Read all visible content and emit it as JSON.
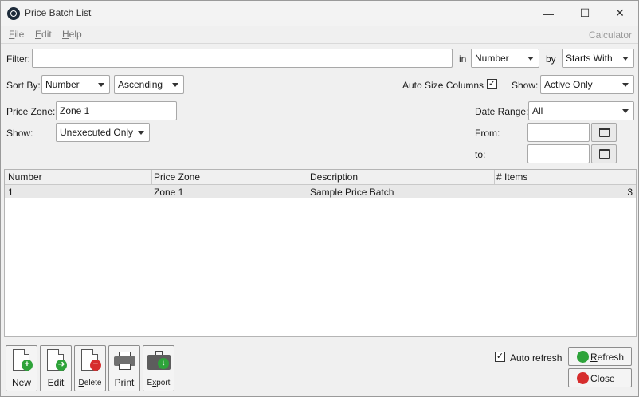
{
  "window": {
    "title": "Price Batch List",
    "controls": {
      "minimize": "—",
      "maximize": "☐",
      "close": "✕"
    }
  },
  "menu": {
    "file_first": "F",
    "file_rest": "ile",
    "edit_first": "E",
    "edit_rest": "dit",
    "help_first": "H",
    "help_rest": "elp",
    "calculator": "Calculator"
  },
  "filter": {
    "label": "Filter:",
    "value": "",
    "in_label": "in",
    "in_value": "Number",
    "by_label": "by",
    "by_value": "Starts With"
  },
  "sort": {
    "label": "Sort By:",
    "field": "Number",
    "direction": "Ascending"
  },
  "auto_size": {
    "label": "Auto Size Columns",
    "checked": true,
    "mark": "✓"
  },
  "show_active": {
    "label": "Show:",
    "value": "Active Only"
  },
  "price_zone": {
    "label": "Price Zone:",
    "value": "Zone 1"
  },
  "show_exec": {
    "label": "Show:",
    "value": "Unexecuted Only"
  },
  "date_range": {
    "label": "Date Range:",
    "value": "All"
  },
  "from": {
    "label": "From:",
    "value": ""
  },
  "to": {
    "label": "to:",
    "value": ""
  },
  "table": {
    "columns": [
      "Number",
      "Price Zone",
      "Description",
      "# Items"
    ],
    "rows": [
      {
        "number": "1",
        "zone": "Zone 1",
        "description": "Sample Price Batch",
        "items": "3"
      }
    ]
  },
  "toolbar": {
    "new_u": "N",
    "new_rest": "ew",
    "edit_first": "E",
    "edit_u": "d",
    "edit_rest": "it",
    "delete_u": "D",
    "delete_rest": "elete",
    "print_first": "P",
    "print_u": "r",
    "print_rest": "int",
    "export_first": "E",
    "export_u": "x",
    "export_rest": "port"
  },
  "auto_refresh": {
    "label": "Auto refresh",
    "checked": true,
    "mark": "✓"
  },
  "refresh_button": {
    "u": "R",
    "rest": "efresh"
  },
  "close_button": {
    "u": "C",
    "rest": "lose"
  },
  "colors": {
    "green": "#2ea33a",
    "red": "#d62d2d",
    "header_bg": "#f0f0f0",
    "row_bg": "#e8e8e8"
  }
}
